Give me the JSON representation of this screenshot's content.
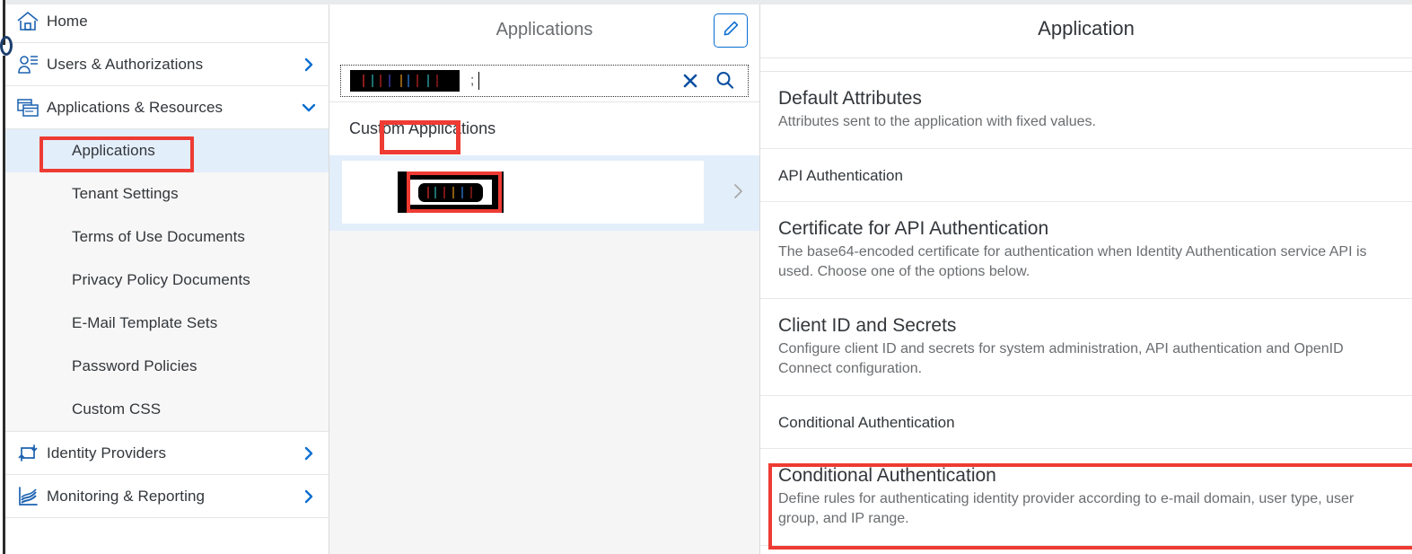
{
  "sidebar": {
    "items": [
      {
        "label": "Home",
        "icon": "home-icon",
        "chevron": ""
      },
      {
        "label": "Users & Authorizations",
        "icon": "users-icon",
        "chevron": "›"
      },
      {
        "label": "Applications & Resources",
        "icon": "applications-icon",
        "chevron": "⌄"
      }
    ],
    "sub_items": [
      {
        "label": "Applications",
        "selected": true
      },
      {
        "label": "Tenant Settings",
        "selected": false
      },
      {
        "label": "Terms of Use Documents",
        "selected": false
      },
      {
        "label": "Privacy Policy Documents",
        "selected": false
      },
      {
        "label": "E-Mail Template Sets",
        "selected": false
      },
      {
        "label": "Password Policies",
        "selected": false
      },
      {
        "label": "Custom CSS",
        "selected": false
      }
    ],
    "bottom_items": [
      {
        "label": "Identity Providers",
        "icon": "identity-providers-icon",
        "chevron": "›"
      },
      {
        "label": "Monitoring & Reporting",
        "icon": "monitoring-icon",
        "chevron": "›"
      }
    ]
  },
  "middle": {
    "title": "Applications",
    "edit_icon": "pencil-icon",
    "search": {
      "value": "",
      "placeholder": "",
      "trailing_text": ";",
      "clear_icon": "close-icon",
      "search_icon": "search-icon"
    },
    "group_title": "Custom Applications",
    "list_item_chevron": "›"
  },
  "right": {
    "title": "Application",
    "sections": [
      {
        "kind": "item",
        "title": "Default Attributes",
        "description": "Attributes sent to the application with fixed values."
      },
      {
        "kind": "group",
        "title": "API Authentication"
      },
      {
        "kind": "item",
        "title": "Certificate for API Authentication",
        "description": "The base64-encoded certificate for authentication when Identity Authentication service API is used. Choose one of the options below."
      },
      {
        "kind": "item",
        "title": "Client ID and Secrets",
        "description": "Configure client ID and secrets for system administration, API authentication and OpenID Connect configuration."
      },
      {
        "kind": "group",
        "title": "Conditional Authentication"
      },
      {
        "kind": "item",
        "title": "Conditional Authentication",
        "description": "Define rules for authenticating identity provider according to e-mail domain, user type, user group, and IP range."
      }
    ]
  },
  "colors": {
    "accent": "#0a6ed1",
    "annotation": "#ee3b33",
    "selected_bg": "#e3eefb",
    "text_primary": "#32363a",
    "text_secondary": "#6a6d70"
  }
}
